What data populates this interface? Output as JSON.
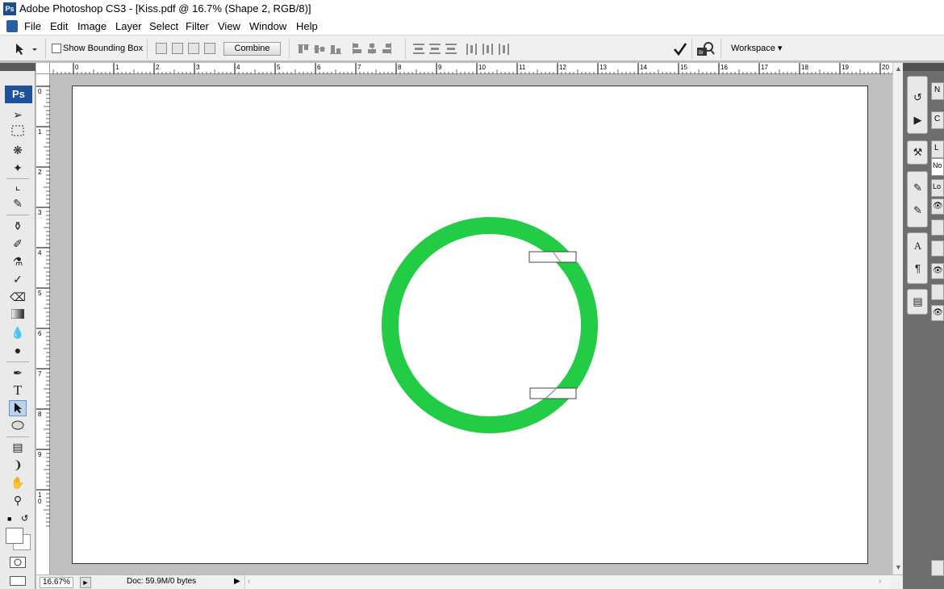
{
  "window": {
    "app_logo": "Ps",
    "title": "Adobe Photoshop CS3 - [Kiss.pdf @ 16.7% (Shape 2, RGB/8)]"
  },
  "menu": {
    "items": [
      "File",
      "Edit",
      "Image",
      "Layer",
      "Select",
      "Filter",
      "View",
      "Window",
      "Help"
    ]
  },
  "options_bar": {
    "show_bounding_box_label": "Show Bounding Box",
    "show_bounding_box_checked": false,
    "combine_label": "Combine",
    "workspace_label": "Workspace ▾",
    "commit_icon": "checkmark-icon",
    "bridge_icon": "bridge-icon"
  },
  "toolbar": {
    "logo": "Ps",
    "active_tool": "path-selection-tool",
    "tools": [
      "move",
      "marquee",
      "lasso",
      "magic-wand",
      "crop",
      "slice",
      "healing",
      "brush",
      "clone-stamp",
      "history-brush",
      "eraser",
      "gradient",
      "blur",
      "dodge",
      "pen",
      "type",
      "path-selection",
      "ellipse",
      "notes",
      "eyedropper",
      "hand",
      "zoom"
    ],
    "type_tool_glyph": "T"
  },
  "rulers": {
    "top_labels": [
      "0",
      "1",
      "2",
      "3",
      "4",
      "5",
      "6",
      "7",
      "8",
      "9",
      "10",
      "11",
      "12",
      "13",
      "14",
      "15",
      "16",
      "17",
      "18",
      "19",
      "20"
    ],
    "left_labels": [
      "0",
      "1",
      "2",
      "3",
      "4",
      "5",
      "6",
      "7",
      "8",
      "9",
      "10"
    ]
  },
  "status_bar": {
    "zoom": "16.67%",
    "doc_info": "Doc: 59.9M/0 bytes"
  },
  "canvas": {
    "shape_color": "#22cc44",
    "background": "#ffffff"
  },
  "right_dock": {
    "panel_tab_letters": [
      "N",
      "C",
      "L",
      "No",
      "Lo"
    ]
  }
}
